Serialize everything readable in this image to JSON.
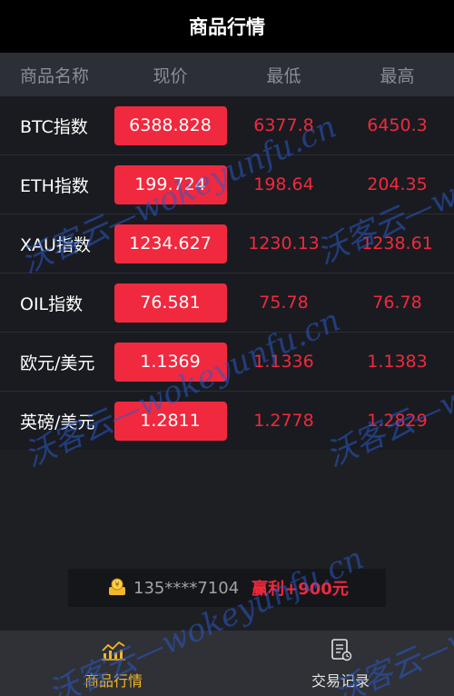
{
  "header": {
    "title": "商品行情"
  },
  "columns": {
    "name": "商品名称",
    "price": "现价",
    "low": "最低",
    "high": "最高"
  },
  "rows": [
    {
      "name": "BTC指数",
      "price": "6388.828",
      "low": "6377.8",
      "high": "6450.3"
    },
    {
      "name": "ETH指数",
      "price": "199.724",
      "low": "198.64",
      "high": "204.35"
    },
    {
      "name": "XAU指数",
      "price": "1234.627",
      "low": "1230.13",
      "high": "1238.61"
    },
    {
      "name": "OIL指数",
      "price": "76.581",
      "low": "75.78",
      "high": "76.78"
    },
    {
      "name": "欧元/美元",
      "price": "1.1369",
      "low": "1.1336",
      "high": "1.1383"
    },
    {
      "name": "英磅/美元",
      "price": "1.2811",
      "low": "1.2778",
      "high": "1.2829"
    }
  ],
  "ticker": {
    "icon": "gold-coin-icon",
    "phone": "135****7104",
    "message": "赢利+900元"
  },
  "tabbar": [
    {
      "label": "商品行情",
      "icon": "chart-icon",
      "active": true
    },
    {
      "label": "交易记录",
      "icon": "document-icon",
      "active": false
    }
  ],
  "watermarks": {
    "w1": "沃客云—wokeyunfu.cn",
    "w2": "沃客云—w",
    "w3": "沃客云—wokeyunfu.cn",
    "w4": "沃客云—w",
    "w5": "沃客云—wokeyunfu.cn",
    "w6": "沃客云—w"
  },
  "colors": {
    "accent": "#f0293e",
    "active_tab": "#f4b728",
    "background": "#1e1f23"
  }
}
